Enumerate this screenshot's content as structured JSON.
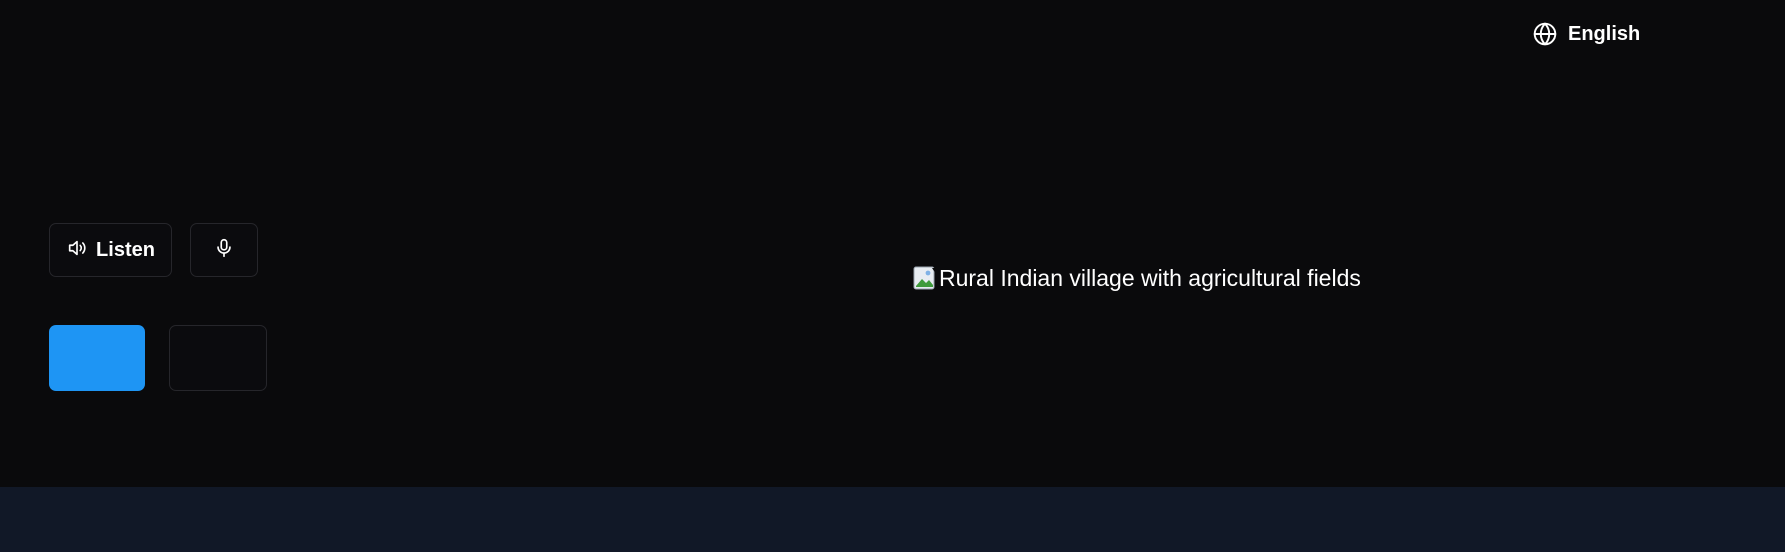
{
  "language_switcher": {
    "icon": "globe-icon",
    "label": "English"
  },
  "audio_controls": {
    "listen_icon": "speaker-icon",
    "listen_label": "Listen",
    "mic_icon": "microphone-icon"
  },
  "cta": {
    "primary_label": "",
    "secondary_label": ""
  },
  "hero_image": {
    "alt": "Rural Indian village with agricultural fields",
    "icon": "broken-image-icon"
  },
  "colors": {
    "background": "#0a0a0c",
    "footer_band": "#111827",
    "accent": "#1e95f4",
    "border": "#26262b"
  }
}
